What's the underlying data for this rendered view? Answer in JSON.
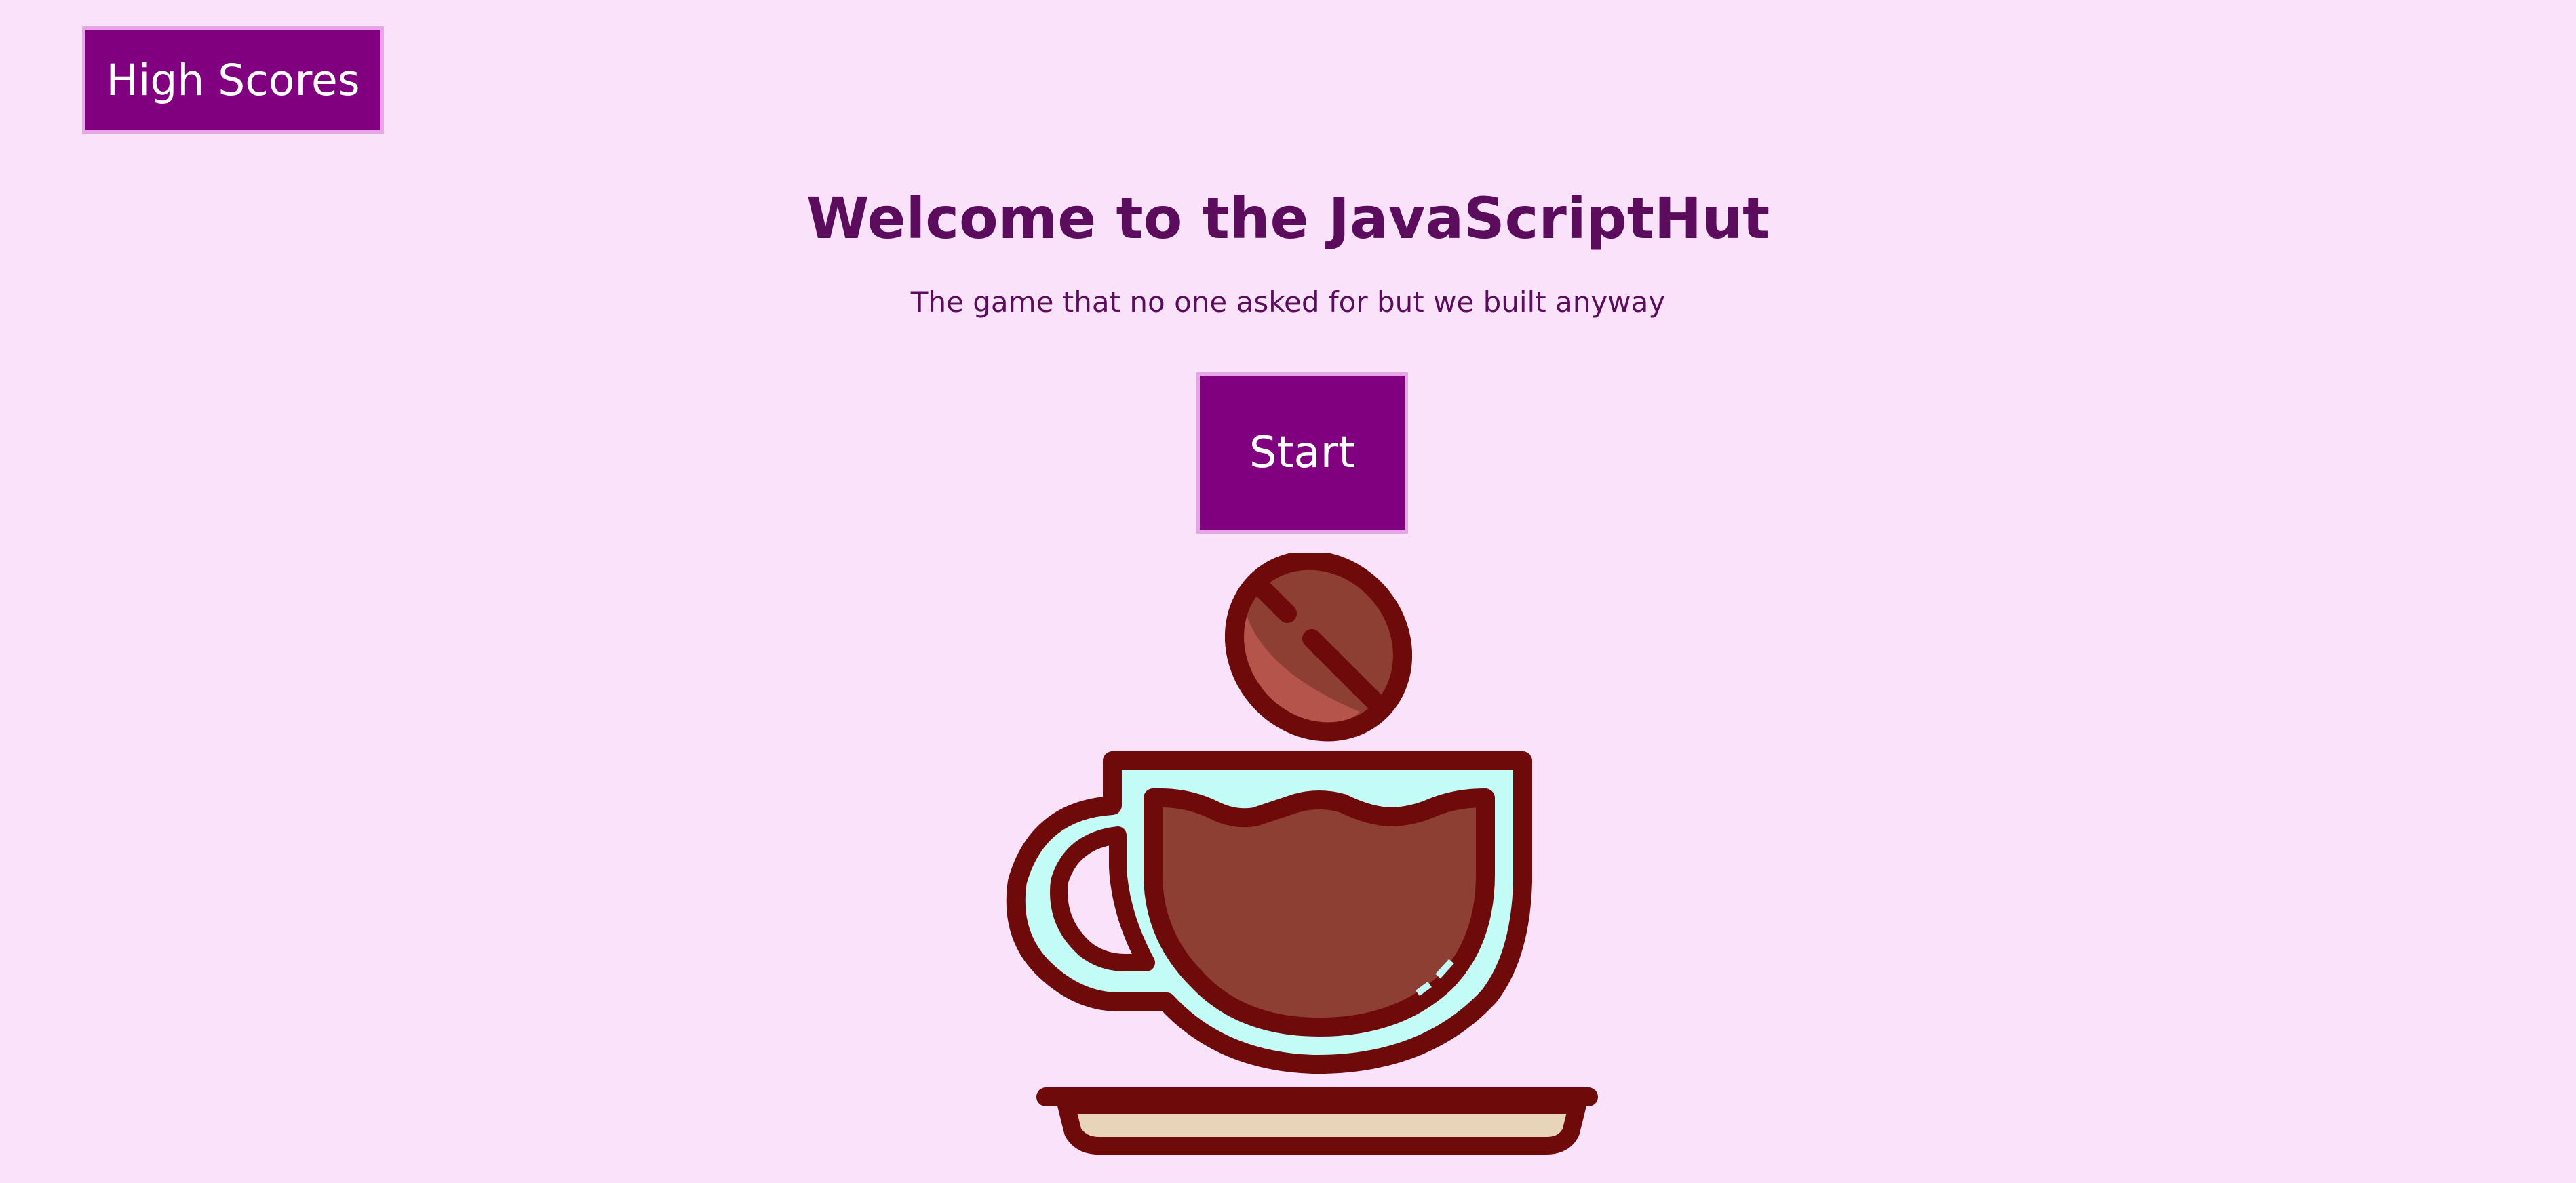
{
  "buttons": {
    "high_scores_label": "High Scores",
    "start_label": "Start"
  },
  "header": {
    "title": "Welcome to the JavaScriptHut",
    "subtitle": "The game that no one asked for but we built anyway"
  },
  "illustration": {
    "icon": "coffee-cup-with-bean-icon"
  },
  "colors": {
    "background": "#fae3fa",
    "button_fill": "#800080",
    "button_border": "#e6a6e6",
    "heading_text": "#5c0c5c",
    "cup_outline": "#6e0a0a",
    "cup_body": "#c3fbf7",
    "coffee": "#8e3f34",
    "bean_light": "#b5544a",
    "saucer": "#e8d5b9"
  }
}
